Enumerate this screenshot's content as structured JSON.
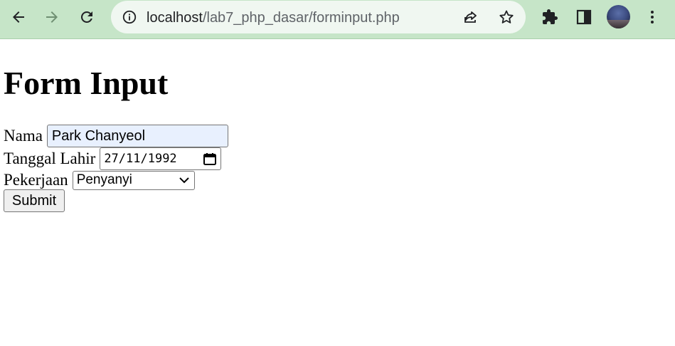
{
  "browser": {
    "url_host": "localhost",
    "url_path": "/lab7_php_dasar/forminput.php",
    "toolbar_color": "#c6e5c8",
    "icons": [
      "back-icon",
      "forward-icon",
      "reload-icon",
      "site-info-icon",
      "share-icon",
      "bookmark-star-icon",
      "extensions-icon",
      "side-panel-icon",
      "profile-avatar",
      "menu-icon"
    ]
  },
  "page": {
    "title": "Form Input",
    "form": {
      "nama_label": "Nama",
      "nama_value": "Park Chanyeol",
      "tanggal_label": "Tanggal Lahir",
      "tanggal_value": "27/11/1992",
      "pekerjaan_label": "Pekerjaan",
      "pekerjaan_selected": "Penyanyi",
      "submit_label": "Submit"
    }
  }
}
